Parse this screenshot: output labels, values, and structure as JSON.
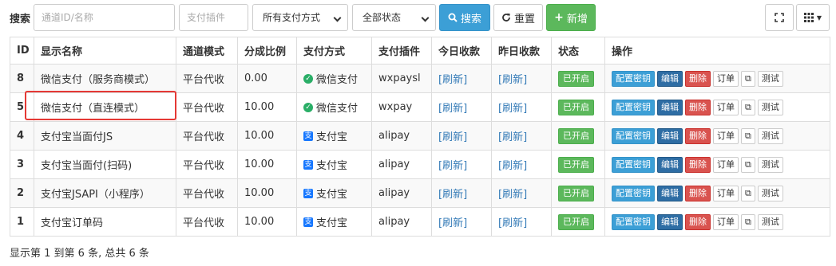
{
  "toolbar": {
    "search_label": "搜索",
    "channel_placeholder": "通道ID/名称",
    "plugin_placeholder": "支付插件",
    "pay_method_select": "所有支付方式",
    "status_select": "全部状态",
    "search_button": "搜索",
    "reset_button": "重置",
    "add_button": "新增"
  },
  "table": {
    "headers": [
      "ID",
      "显示名称",
      "通道模式",
      "分成比例",
      "支付方式",
      "支付插件",
      "今日收款",
      "昨日收款",
      "状态",
      "操作"
    ],
    "rows": [
      {
        "id": "8",
        "name": "微信支付（服务商模式）",
        "mode": "平台代收",
        "ratio": "0.00",
        "method": "微信支付",
        "method_icon": "wechat-icon",
        "plugin": "wxpaysl",
        "today": "[刷新]",
        "yesterday": "[刷新]",
        "status": "已开启"
      },
      {
        "id": "5",
        "name": "微信支付（直连模式）",
        "mode": "平台代收",
        "ratio": "10.00",
        "method": "微信支付",
        "method_icon": "wechat-icon",
        "plugin": "wxpay",
        "today": "[刷新]",
        "yesterday": "[刷新]",
        "status": "已开启"
      },
      {
        "id": "4",
        "name": "支付宝当面付JS",
        "mode": "平台代收",
        "ratio": "10.00",
        "method": "支付宝",
        "method_icon": "alipay-icon",
        "plugin": "alipay",
        "today": "[刷新]",
        "yesterday": "[刷新]",
        "status": "已开启"
      },
      {
        "id": "3",
        "name": "支付宝当面付(扫码)",
        "mode": "平台代收",
        "ratio": "10.00",
        "method": "支付宝",
        "method_icon": "alipay-icon",
        "plugin": "alipay",
        "today": "[刷新]",
        "yesterday": "[刷新]",
        "status": "已开启"
      },
      {
        "id": "2",
        "name": "支付宝JSAPI（小程序）",
        "mode": "平台代收",
        "ratio": "10.00",
        "method": "支付宝",
        "method_icon": "alipay-icon",
        "plugin": "alipay",
        "today": "[刷新]",
        "yesterday": "[刷新]",
        "status": "已开启"
      },
      {
        "id": "1",
        "name": "支付宝订单码",
        "mode": "平台代收",
        "ratio": "10.00",
        "method": "支付宝",
        "method_icon": "alipay-icon",
        "plugin": "alipay",
        "today": "[刷新]",
        "yesterday": "[刷新]",
        "status": "已开启"
      }
    ],
    "actions": {
      "key": "配置密钥",
      "edit": "编辑",
      "delete": "删除",
      "order": "订单",
      "test": "测试"
    }
  },
  "footer": {
    "summary": "显示第 1 到第 6 条, 总共 6 条"
  },
  "colors": {
    "primary": "#3c9fd6",
    "success": "#5cb85c",
    "danger": "#d9534f",
    "highlight": "#e53935"
  }
}
